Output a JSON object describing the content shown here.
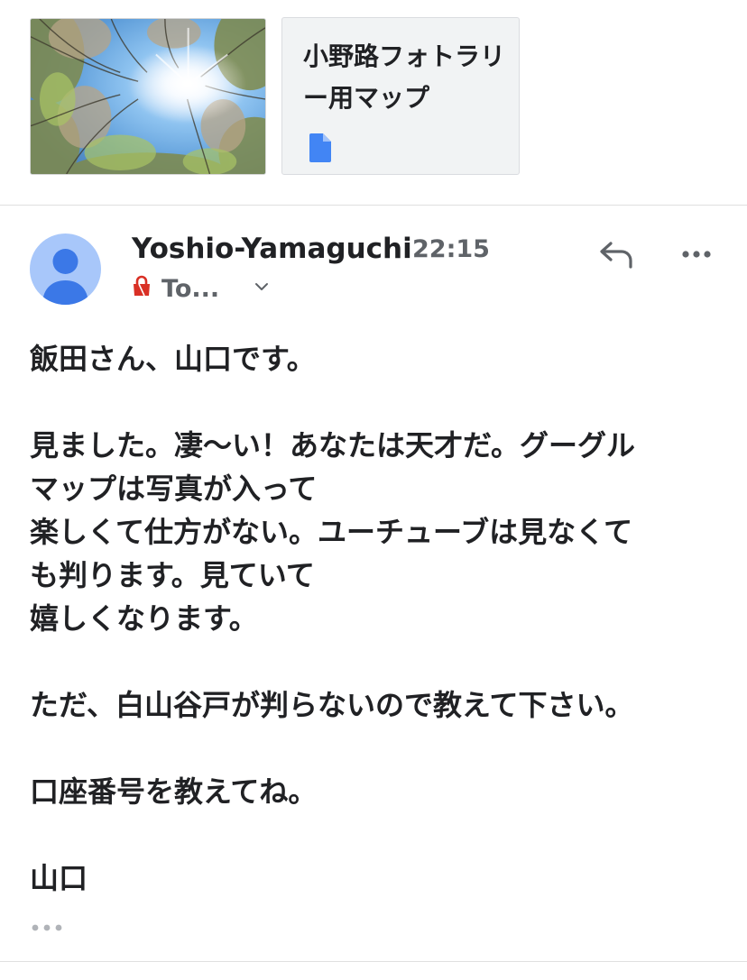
{
  "attachments": {
    "file_name": "小野路フォトラリー用マップ",
    "file_icon": "google-docs-file-icon",
    "image_icon": "photo-thumbnail"
  },
  "message": {
    "sender": "Yoshio-Yamaguchi",
    "time": "22:15",
    "to_label": "To...",
    "icons": {
      "lock": "red-lock-icon",
      "expand": "chevron-down-icon",
      "reply": "reply-icon",
      "more": "more-horizontal-icon",
      "avatar": "default-person-avatar"
    },
    "body_lines": [
      "飯田さん、山口です。",
      "",
      "見ました。凄〜い！あなたは天才だ。グーグル",
      "マップは写真が入って",
      "楽しくて仕方がない。ユーチューブは見なくて",
      "も判ります。見ていて",
      "嬉しくなります。",
      "",
      "ただ、白山谷戸が判らないので教えて下さい。",
      "",
      "口座番号を教えてね。",
      "",
      "山口"
    ],
    "trimmed_content_label": "•••"
  },
  "colors": {
    "avatar_bg": "#a8c7fa",
    "avatar_fg": "#3b78e7",
    "file_icon": "#4285f4",
    "lock": "#d93025",
    "icon_gray": "#5f6368"
  }
}
